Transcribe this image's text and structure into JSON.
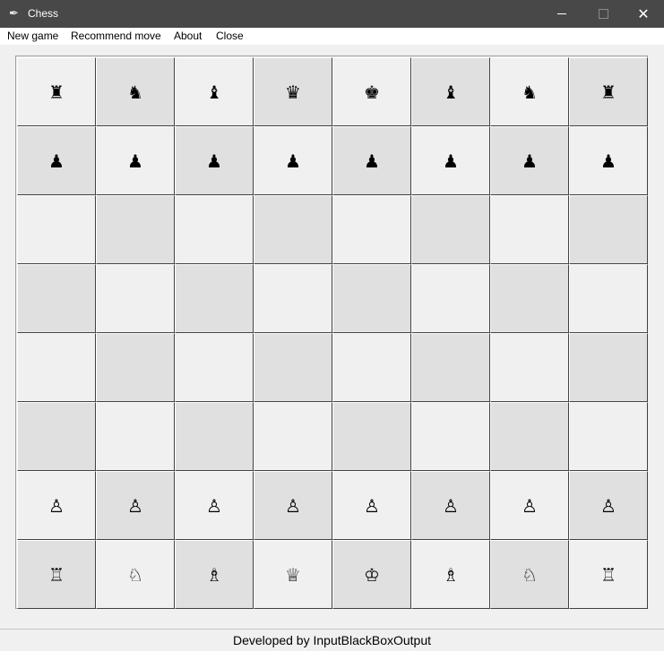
{
  "window": {
    "title": "Chess",
    "icon": "feather-icon",
    "controls": {
      "minimize": "minimize-icon",
      "maximize": "maximize-icon",
      "close": "close-icon"
    }
  },
  "menu": {
    "items": [
      {
        "label": "New game"
      },
      {
        "label": "Recommend move"
      },
      {
        "label": "About"
      },
      {
        "label": "Close"
      }
    ]
  },
  "board": {
    "light_color": "#f0f0f0",
    "dark_color": "#e0e0e0",
    "rows": [
      [
        "♜",
        "♞",
        "♝",
        "♛",
        "♚",
        "♝",
        "♞",
        "♜"
      ],
      [
        "♟",
        "♟",
        "♟",
        "♟",
        "♟",
        "♟",
        "♟",
        "♟"
      ],
      [
        "",
        "",
        "",
        "",
        "",
        "",
        "",
        ""
      ],
      [
        "",
        "",
        "",
        "",
        "",
        "",
        "",
        ""
      ],
      [
        "",
        "",
        "",
        "",
        "",
        "",
        "",
        ""
      ],
      [
        "",
        "",
        "",
        "",
        "",
        "",
        "",
        ""
      ],
      [
        "♙",
        "♙",
        "♙",
        "♙",
        "♙",
        "♙",
        "♙",
        "♙"
      ],
      [
        "♖",
        "♘",
        "♗",
        "♕",
        "♔",
        "♗",
        "♘",
        "♖"
      ]
    ]
  },
  "status": {
    "text": "Developed by InputBlackBoxOutput"
  }
}
